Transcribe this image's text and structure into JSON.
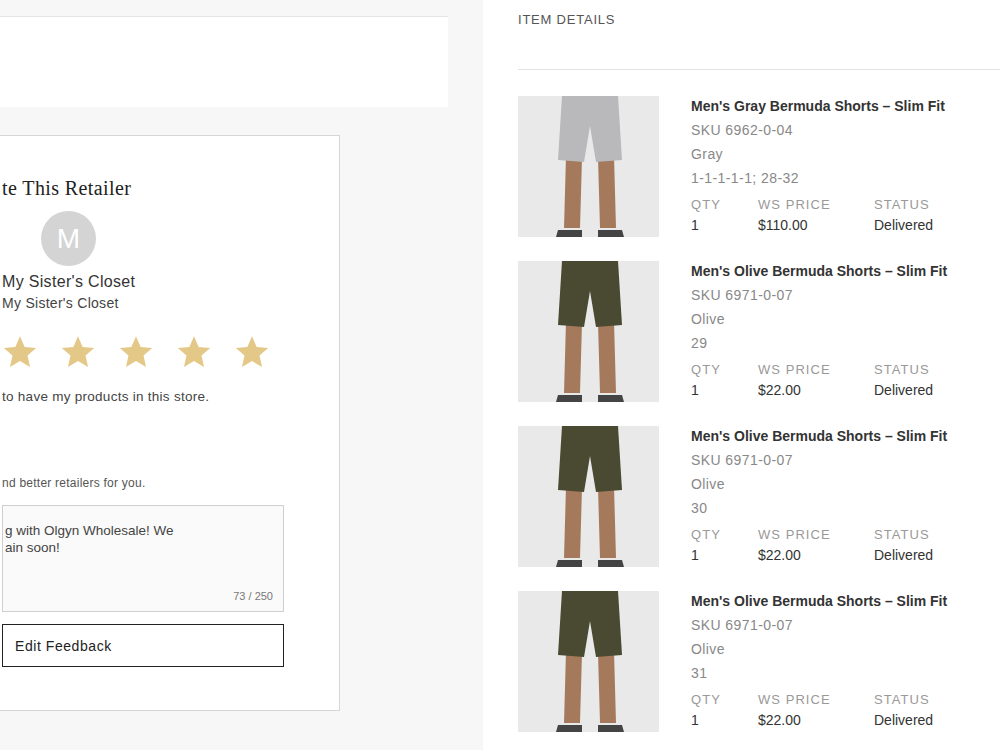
{
  "retailer_card": {
    "heading": "te This Retailer",
    "avatar": "M",
    "name": "My Sister's Closet",
    "subname": "My Sister's Closet",
    "stars": 5,
    "rating_text": "to have my products in this store.",
    "helper_text": "nd better retailers for you.",
    "feedback_lines": [
      "g with Olgyn Wholesale! We",
      "ain soon!"
    ],
    "counter": "73 / 250",
    "button": "Edit Feedback"
  },
  "item_details": {
    "title": "ITEM DETAILS",
    "labels": [
      "QTY",
      "WS PRICE",
      "STATUS"
    ],
    "items": [
      {
        "name": "Men's Gray Bermuda Shorts – Slim Fit",
        "sku": "SKU 6962-0-04",
        "color_name": "Gray",
        "size": "1-1-1-1-1; 28-32",
        "qty": "1",
        "price": "$110.00",
        "status": "Delivered",
        "color": "#b9b9bc"
      },
      {
        "name": "Men's Olive Bermuda Shorts – Slim Fit",
        "sku": "SKU 6971-0-07",
        "color_name": "Olive",
        "size": "29",
        "qty": "1",
        "price": "$22.00",
        "status": "Delivered",
        "color": "#4a4a32"
      },
      {
        "name": "Men's Olive Bermuda Shorts – Slim Fit",
        "sku": "SKU 6971-0-07",
        "color_name": "Olive",
        "size": "30",
        "qty": "1",
        "price": "$22.00",
        "status": "Delivered",
        "color": "#4a4a32"
      },
      {
        "name": "Men's Olive Bermuda Shorts – Slim Fit",
        "sku": "SKU 6971-0-07",
        "color_name": "Olive",
        "size": "31",
        "qty": "1",
        "price": "$22.00",
        "status": "Delivered",
        "color": "#4a4a32"
      }
    ]
  }
}
